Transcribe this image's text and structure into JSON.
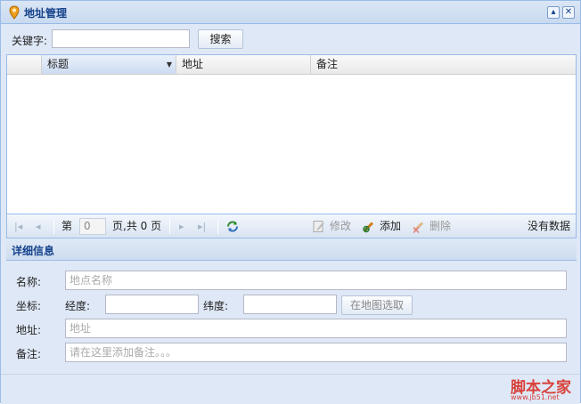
{
  "window": {
    "title": "地址管理"
  },
  "search": {
    "label": "关键字:",
    "value": "",
    "button": "搜索"
  },
  "grid": {
    "columns": [
      "标题",
      "地址",
      "备注"
    ],
    "rows": []
  },
  "pager": {
    "page_prefix": "第",
    "current_page": "0",
    "page_suffix": "页,共 0 页",
    "edit": "修改",
    "add": "添加",
    "delete": "删除",
    "status": "没有数据"
  },
  "details": {
    "title": "详细信息",
    "name_label": "名称:",
    "name_placeholder": "地点名称",
    "coord_label": "坐标:",
    "lng_label": "经度:",
    "lat_label": "纬度:",
    "pick_button": "在地图选取",
    "address_label": "地址:",
    "address_placeholder": "地址",
    "note_label": "备注:",
    "note_placeholder": "请在这里添加备注。。。"
  },
  "watermark": {
    "text": "脚本之家",
    "url": "www.jb51.net"
  },
  "colors": {
    "title": "#15428b",
    "border": "#99bbe8",
    "panel": "#dfe8f6",
    "watermark": "#d8423c"
  },
  "icons": [
    "location-pin-icon",
    "collapse-icon",
    "close-icon",
    "first-page-icon",
    "prev-page-icon",
    "next-page-icon",
    "last-page-icon",
    "refresh-icon",
    "edit-icon",
    "add-icon",
    "delete-icon"
  ]
}
